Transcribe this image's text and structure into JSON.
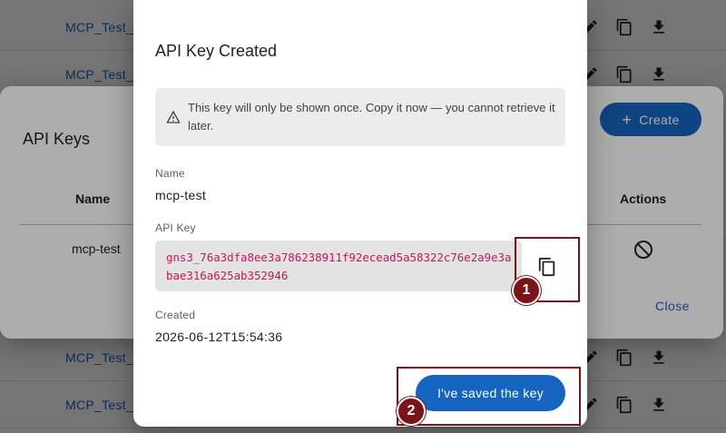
{
  "background": {
    "rows": [
      {
        "name": "MCP_Test_"
      },
      {
        "name": "MCP_Test_"
      },
      {
        "name": ""
      },
      {
        "name": ""
      },
      {
        "name": ""
      },
      {
        "name": ""
      },
      {
        "name": ""
      },
      {
        "name": "MCP_Test_"
      },
      {
        "name": "MCP_Test_"
      }
    ],
    "row_icons": [
      "edit-icon",
      "duplicate-icon",
      "download-icon"
    ]
  },
  "keys_dialog": {
    "title": "API Keys",
    "create_label": "Create",
    "columns": {
      "name": "Name",
      "actions": "Actions"
    },
    "rows": [
      {
        "name": "mcp-test",
        "action_icon": "revoke-icon"
      }
    ],
    "close_label": "Close"
  },
  "created_dialog": {
    "title": "API Key Created",
    "warning": "This key will only be shown once. Copy it now — you cannot retrieve it later.",
    "name_label": "Name",
    "name_value": "mcp-test",
    "key_label": "API Key",
    "key_value": "gns3_76a3dfa8ee3a786238911f92ecead5a58322c76e2a9e3abae316a625ab352946",
    "created_label": "Created",
    "created_value": "2026-06-12T15:54:36",
    "saved_label": "I've saved the key",
    "copy_icon": "copy-icon"
  },
  "markers": [
    {
      "label": "1",
      "target": "copy-button"
    },
    {
      "label": "2",
      "target": "saved-key-button"
    }
  ],
  "colors": {
    "accent": "#1565c0",
    "marker": "#7b1416",
    "key_text": "#c2185b"
  }
}
